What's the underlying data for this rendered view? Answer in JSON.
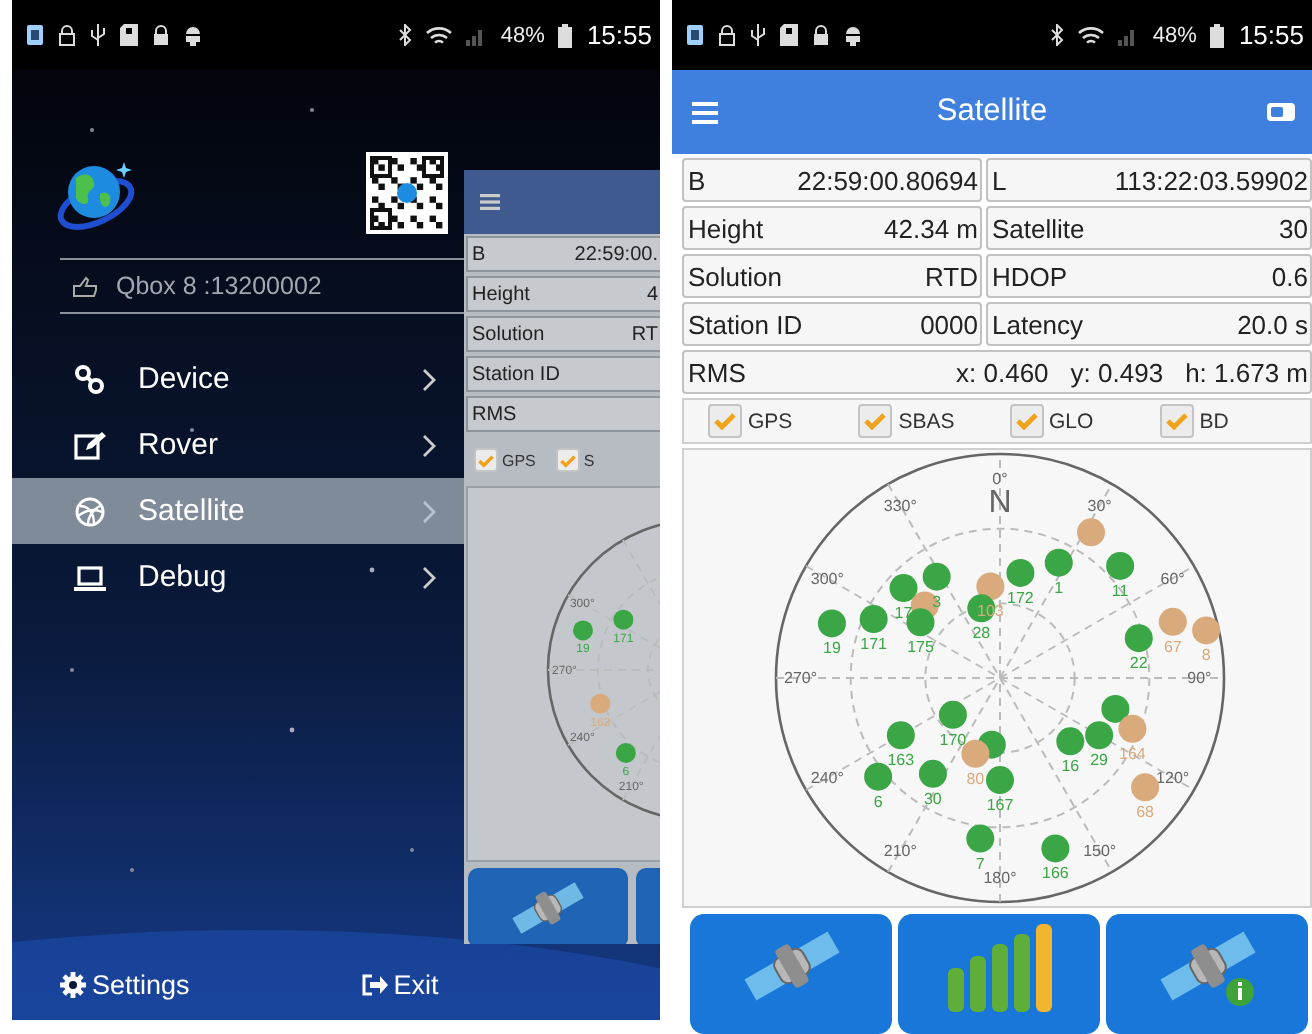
{
  "drawer_screen": {
    "status_bar": {
      "battery": "48%",
      "time": "15:55"
    },
    "device": "Qbox 8 :13200002",
    "menu": [
      {
        "label": "Device",
        "kind": "device",
        "selected": false
      },
      {
        "label": "Rover",
        "kind": "rover",
        "selected": false
      },
      {
        "label": "Satellite",
        "kind": "satellite",
        "selected": true
      },
      {
        "label": "Debug",
        "kind": "debug",
        "selected": false
      }
    ],
    "footer": [
      {
        "label": "Settings",
        "kind": "settings"
      },
      {
        "label": "Exit",
        "kind": "exit"
      }
    ],
    "preview": {
      "fields": [
        {
          "label": "B",
          "value": "22:59:00."
        },
        {
          "label": "Height",
          "value": "4"
        },
        {
          "label": "Solution",
          "value": "RT"
        },
        {
          "label": "Station ID"
        },
        {
          "label": "RMS"
        }
      ],
      "systems": [
        {
          "label": "GPS",
          "checked": true
        },
        {
          "label": "S",
          "checked": true
        }
      ],
      "bearings": [
        "300°",
        "270°",
        "240°",
        "210°"
      ],
      "satellites": [
        {
          "label": "19",
          "color": "#3aa645"
        },
        {
          "label": "171",
          "color": "#3aa645"
        },
        {
          "label": "163",
          "color": "#d9ab7c"
        },
        {
          "label": "6",
          "color": "#3aa645"
        }
      ],
      "buttons": [
        {
          "kind": "satellite"
        },
        {
          "kind": "none"
        }
      ]
    }
  },
  "satellite_screen": {
    "status_bar": {
      "battery": "48%",
      "time": "15:55"
    },
    "title": "Satellite",
    "fields": [
      {
        "label": "B",
        "value": "22:59:00.80694"
      },
      {
        "label": "L",
        "value": "113:22:03.59902"
      },
      {
        "label": "Height",
        "value": "42.34 m"
      },
      {
        "label": "Satellite",
        "value": "30"
      },
      {
        "label": "Solution",
        "value": "RTD"
      },
      {
        "label": "HDOP",
        "value": "0.6"
      },
      {
        "label": "Station ID",
        "value": "0000"
      },
      {
        "label": "Latency",
        "value": "20.0 s"
      }
    ],
    "rms": {
      "label": "RMS",
      "values": [
        "x: 0.460",
        "y: 0.493",
        "h: 1.673 m"
      ]
    },
    "systems": [
      {
        "label": "GPS",
        "checked": true
      },
      {
        "label": "SBAS",
        "checked": true
      },
      {
        "label": "GLO",
        "checked": true
      },
      {
        "label": "BD",
        "checked": true
      }
    ],
    "skyplot": {
      "north": "N",
      "bearings": [
        "0°",
        "30°",
        "60°",
        "90°",
        "120°",
        "150°",
        "180°",
        "210°",
        "240°",
        "270°",
        "300°",
        "330°"
      ],
      "satellites": [
        {
          "color": "#d9ab7c"
        },
        {
          "label": "3",
          "color": "#3aa645"
        },
        {
          "label": "172",
          "color": "#3aa645"
        },
        {
          "label": "1",
          "color": "#3aa645"
        },
        {
          "label": "11",
          "color": "#3aa645"
        },
        {
          "label": "17",
          "color": "#3aa645"
        },
        {
          "label": "103",
          "color": "#d9ab7c"
        },
        {
          "color": "#d9ab7c"
        },
        {
          "label": "28",
          "color": "#3aa645"
        },
        {
          "label": "19",
          "color": "#3aa645"
        },
        {
          "label": "171",
          "color": "#3aa645"
        },
        {
          "label": "175",
          "color": "#3aa645"
        },
        {
          "label": "22",
          "color": "#3aa645"
        },
        {
          "label": "67",
          "color": "#d9ab7c"
        },
        {
          "label": "8",
          "color": "#d9ab7c"
        },
        {
          "label": "170",
          "color": "#3aa645"
        },
        {
          "color": "#3aa645"
        },
        {
          "label": "163",
          "color": "#3aa645"
        },
        {
          "color": "#3aa645"
        },
        {
          "label": "16",
          "color": "#3aa645"
        },
        {
          "label": "29",
          "color": "#3aa645"
        },
        {
          "label": "164",
          "color": "#d9ab7c"
        },
        {
          "label": "80",
          "color": "#d9ab7c"
        },
        {
          "label": "6",
          "color": "#3aa645"
        },
        {
          "label": "30",
          "color": "#3aa645"
        },
        {
          "label": "167",
          "color": "#3aa645"
        },
        {
          "label": "68",
          "color": "#d9ab7c"
        },
        {
          "label": "7",
          "color": "#3aa645"
        },
        {
          "label": "166",
          "color": "#3aa645"
        }
      ]
    },
    "buttons": [
      {
        "kind": "satellite"
      },
      {
        "kind": "signal"
      },
      {
        "kind": "satellite_info"
      }
    ]
  }
}
